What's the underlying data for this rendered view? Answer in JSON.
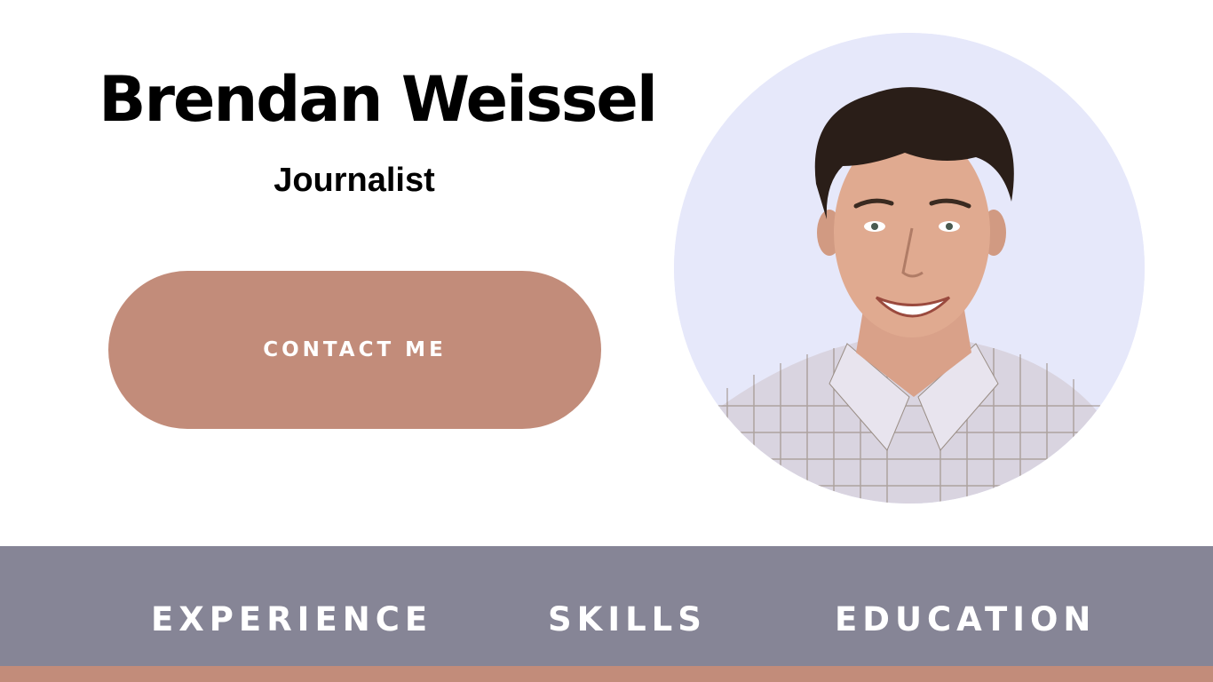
{
  "header": {
    "name": "Brendan Weissel",
    "role": "Journalist"
  },
  "cta": {
    "label": "CONTACT ME"
  },
  "portrait": {
    "alt": "profile-photo"
  },
  "nav": {
    "items": [
      {
        "label": "EXPERIENCE"
      },
      {
        "label": "SKILLS"
      },
      {
        "label": "EDUCATION"
      }
    ]
  },
  "colors": {
    "accent": "#c28c7a",
    "nav_background": "#868596",
    "portrait_background": "#e6e8fa",
    "text": "#000000"
  }
}
